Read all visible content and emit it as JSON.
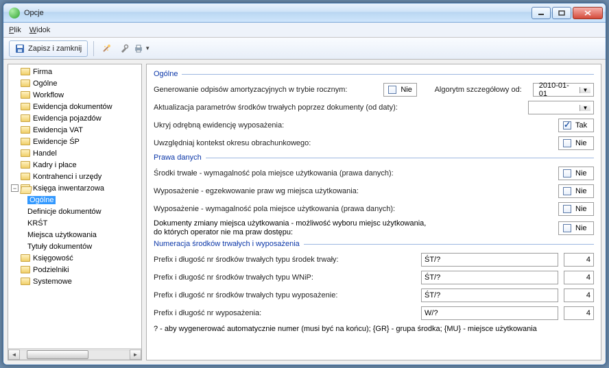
{
  "window": {
    "title": "Opcje"
  },
  "menubar": {
    "plik": "Plik",
    "widok": "Widok"
  },
  "toolbar": {
    "save_close": "Zapisz i zamknij",
    "icons": {
      "save": "save-icon",
      "wand": "wand-icon",
      "tools": "tools-icon",
      "print": "print-icon"
    }
  },
  "tree": [
    {
      "lvl": 0,
      "type": "folder",
      "label": "Firma"
    },
    {
      "lvl": 0,
      "type": "folder",
      "label": "Ogólne"
    },
    {
      "lvl": 0,
      "type": "folder",
      "label": "Workflow"
    },
    {
      "lvl": 0,
      "type": "folder",
      "label": "Ewidencja dokumentów"
    },
    {
      "lvl": 0,
      "type": "folder",
      "label": "Ewidencja pojazdów"
    },
    {
      "lvl": 0,
      "type": "folder",
      "label": "Ewidencja VAT"
    },
    {
      "lvl": 0,
      "type": "folder",
      "label": "Ewidencje ŚP"
    },
    {
      "lvl": 0,
      "type": "folder",
      "label": "Handel"
    },
    {
      "lvl": 0,
      "type": "folder",
      "label": "Kadry i płace"
    },
    {
      "lvl": 0,
      "type": "folder",
      "label": "Kontrahenci i urzędy"
    },
    {
      "lvl": 0,
      "type": "folder-open",
      "exp": "-",
      "label": "Księga inwentarzowa"
    },
    {
      "lvl": 1,
      "type": "none",
      "label": "Ogólne",
      "selected": true
    },
    {
      "lvl": 1,
      "type": "none",
      "label": "Definicje dokumentów"
    },
    {
      "lvl": 1,
      "type": "none",
      "label": "KRŚT"
    },
    {
      "lvl": 1,
      "type": "none",
      "label": "Miejsca użytkowania"
    },
    {
      "lvl": 1,
      "type": "none",
      "label": "Tytuły dokumentów"
    },
    {
      "lvl": 0,
      "type": "folder",
      "label": "Księgowość"
    },
    {
      "lvl": 0,
      "type": "folder",
      "label": "Podzielniki"
    },
    {
      "lvl": 0,
      "type": "folder",
      "label": "Systemowe"
    }
  ],
  "form": {
    "grp_ogolne": "Ogólne",
    "grp_prawa": "Prawa danych",
    "grp_numer": "Numeracja środków trwałych i wyposażenia",
    "row_gen_amort": "Generowanie odpisów amortyzacyjnych w trybie rocznym:",
    "row_gen_amort_val": "Nie",
    "row_alg": "Algorytm szczegółowy od:",
    "row_alg_val": "2010-01-01",
    "row_akt": "Aktualizacja parametrów środków trwałych poprzez dokumenty (od daty):",
    "row_akt_val": "",
    "row_ukryj": "Ukryj odrębną ewidencję wyposażenia:",
    "row_ukryj_val": "Tak",
    "row_ukryj_checked": true,
    "row_uwzg": "Uwzględniaj kontekst okresu obrachunkowego:",
    "row_uwzg_val": "Nie",
    "row_p1": "Środki trwałe - wymagalność pola miejsce użytkowania (prawa danych):",
    "row_p1_val": "Nie",
    "row_p2": "Wyposażenie - egzekwowanie praw wg miejsca użytkowania:",
    "row_p2_val": "Nie",
    "row_p3": "Wyposażenie - wymagalność pola miejsce użytkowania (prawa danych):",
    "row_p3_val": "Nie",
    "row_p4a": "Dokumenty zmiany miejsca użytkowania - możliwość wyboru miejsc użytkowania,",
    "row_p4b": "do których operator nie ma praw dostępu:",
    "row_p4_val": "Nie",
    "row_n1": "Prefix i długość nr środków trwałych typu środek trwały:",
    "row_n1_prefix": "ŚT/?",
    "row_n1_len": "4",
    "row_n2": "Prefix i długość nr środków trwałych typu WNiP:",
    "row_n2_prefix": "ŚT/?",
    "row_n2_len": "4",
    "row_n3": "Prefix i długość nr środków trwałych typu wyposażenie:",
    "row_n3_prefix": "ŚT/?",
    "row_n3_len": "4",
    "row_n4": "Prefix i długość nr wyposażenia:",
    "row_n4_prefix": "W/?",
    "row_n4_len": "4",
    "hint": "? - aby wygenerować automatycznie numer (musi być na końcu); {GR} - grupa środka; {MU} - miejsce użytkowania"
  }
}
